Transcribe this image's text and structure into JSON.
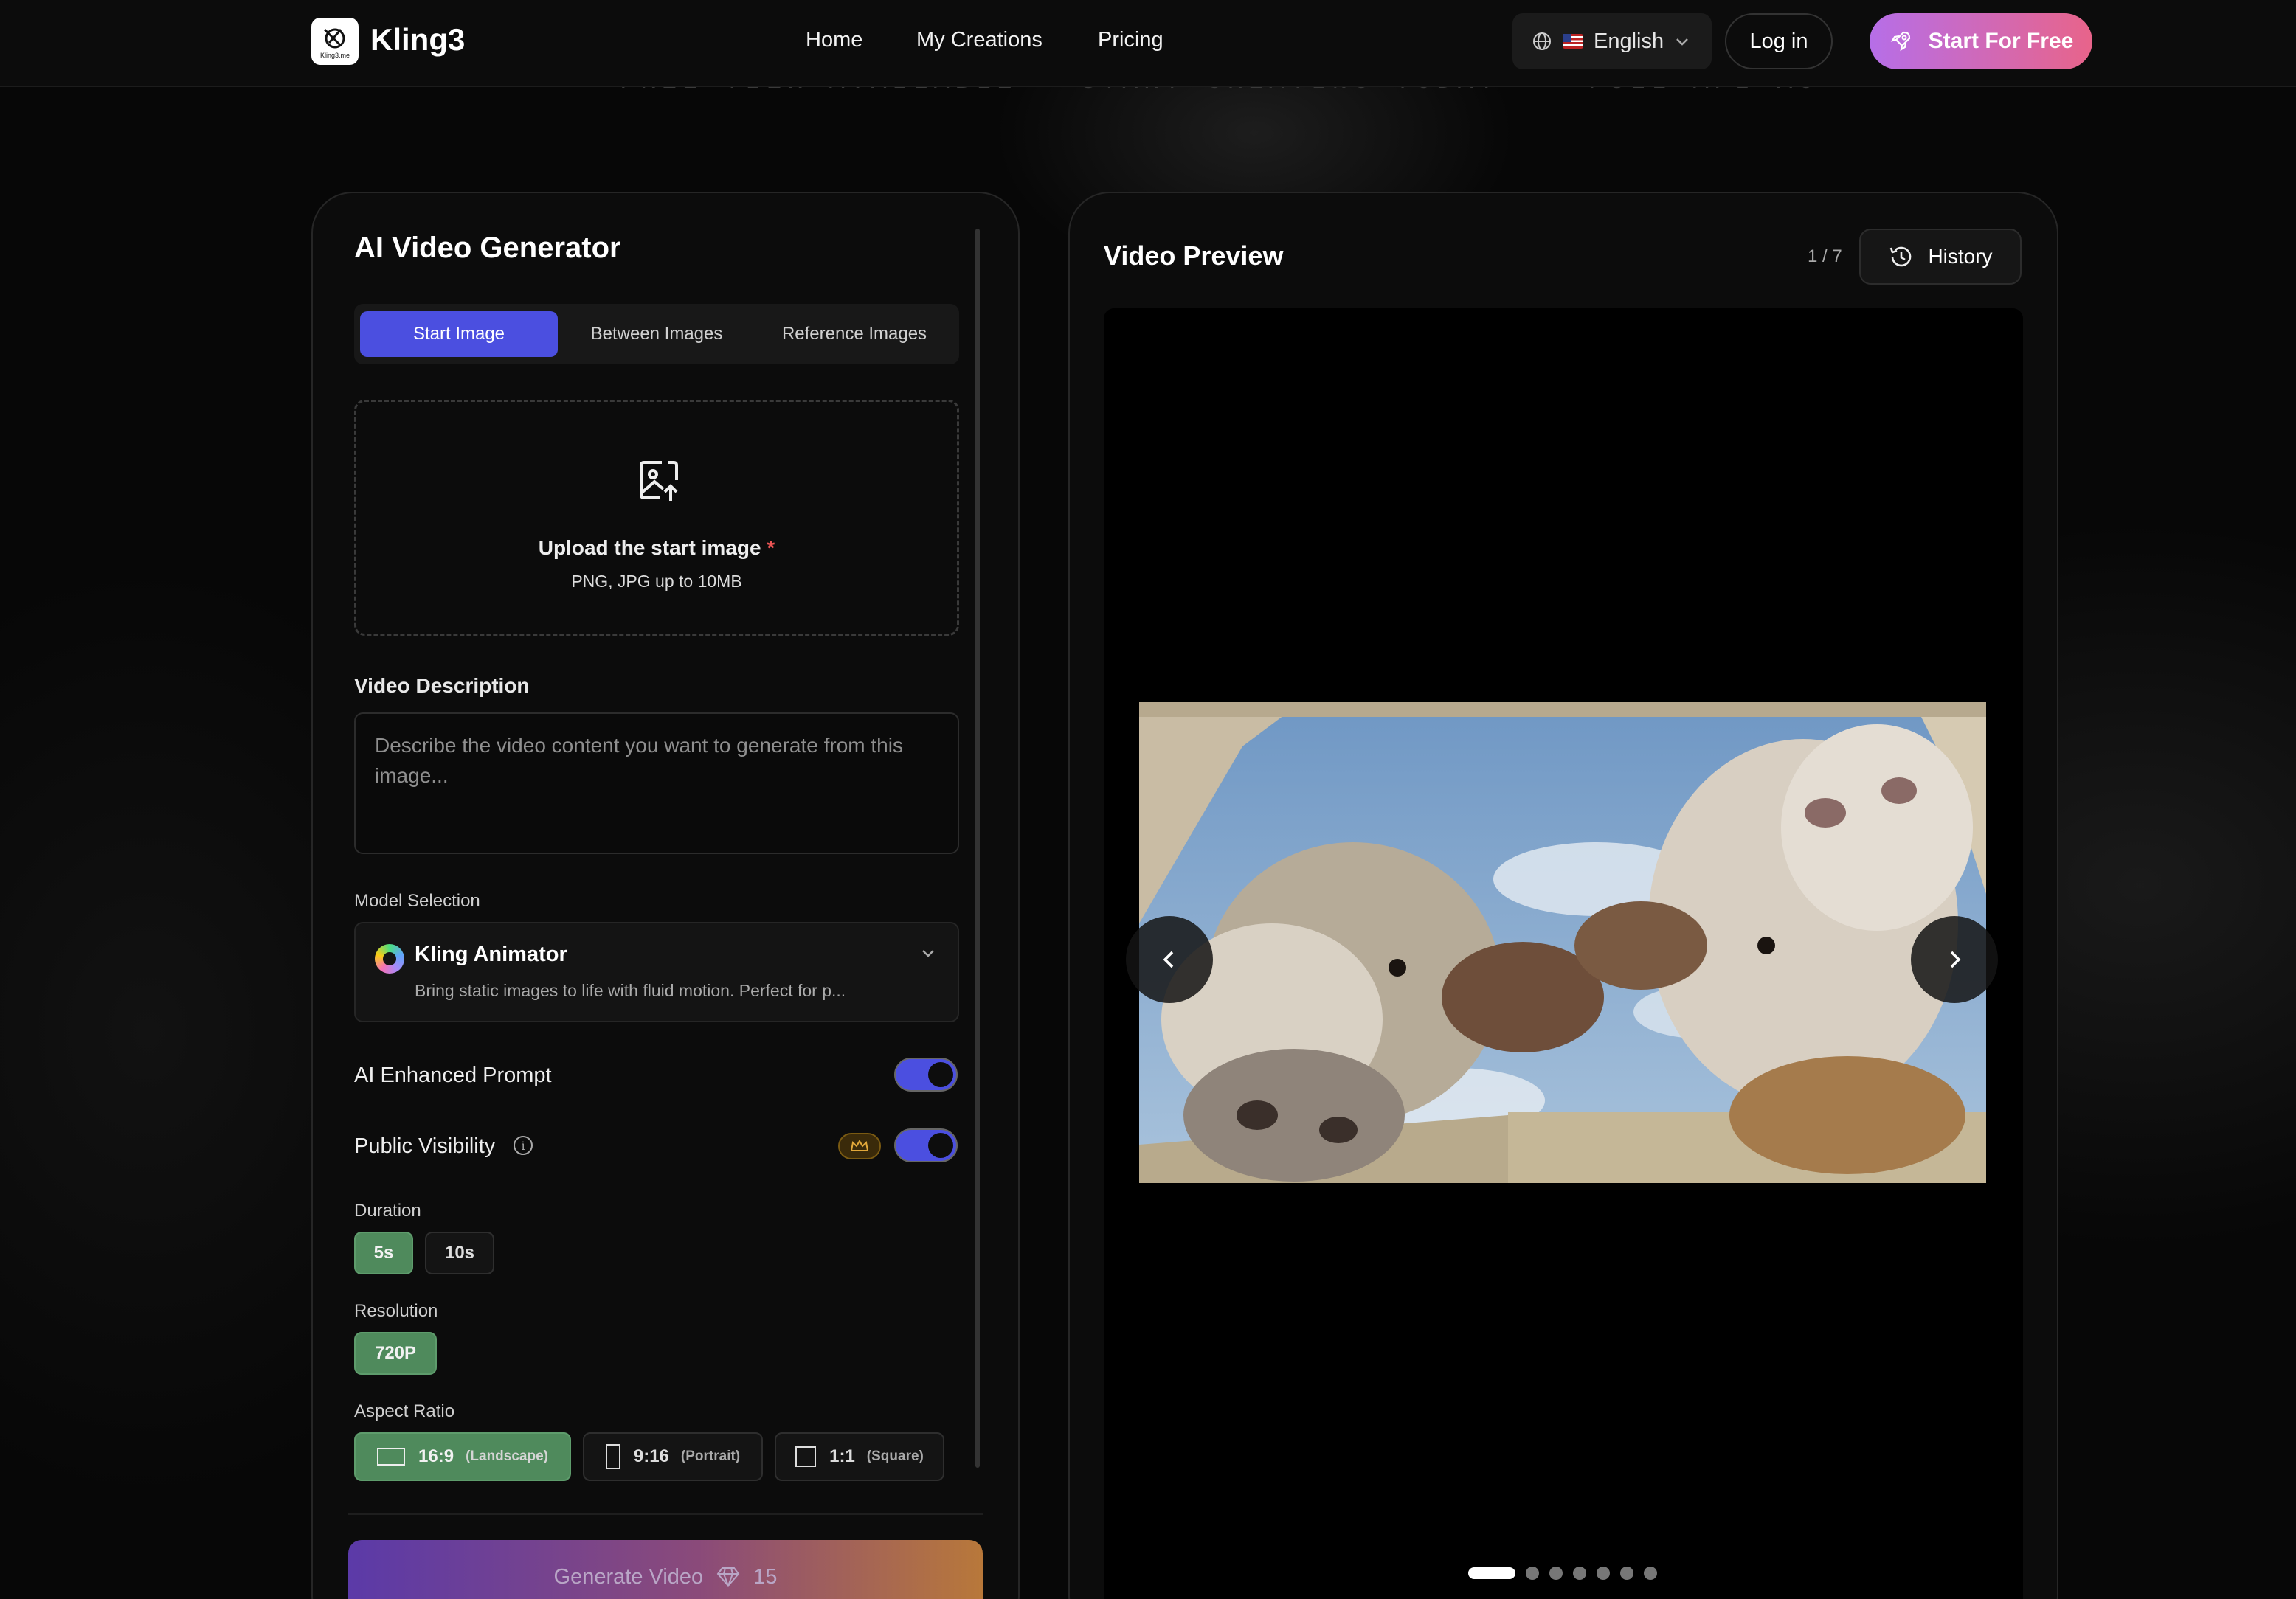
{
  "nav": {
    "brand": "Kling3",
    "logo_sub": "Kling3.me",
    "links": [
      "Home",
      "My Creations",
      "Pricing"
    ],
    "language": "English",
    "login": "Log in",
    "cta": "Start For Free"
  },
  "banner": {
    "items": [
      "FREE TIER AVAILABLE · START CREATING TODAY",
      "FULL API ACCESS FOR DEVELOPERS"
    ]
  },
  "generator": {
    "title": "AI Video Generator",
    "tabs": [
      "Start Image",
      "Between Images",
      "Reference Images"
    ],
    "active_tab": "Start Image",
    "upload": {
      "title": "Upload the start image",
      "required_mark": "*",
      "hint": "PNG, JPG up to 10MB"
    },
    "description": {
      "label": "Video Description",
      "placeholder": "Describe the video content you want to generate from this image..."
    },
    "model": {
      "label": "Model Selection",
      "name": "Kling Animator",
      "description": "Bring static images to life with fluid motion. Perfect for p..."
    },
    "ai_enhanced": {
      "label": "AI Enhanced Prompt",
      "enabled": true
    },
    "public_visibility": {
      "label": "Public Visibility",
      "enabled": true
    },
    "duration": {
      "label": "Duration",
      "options": [
        "5s",
        "10s"
      ],
      "selected": "5s"
    },
    "resolution": {
      "label": "Resolution",
      "options": [
        "720P"
      ],
      "selected": "720P"
    },
    "aspect_ratio": {
      "label": "Aspect Ratio",
      "options": [
        {
          "ratio": "16:9",
          "name": "(Landscape)"
        },
        {
          "ratio": "9:16",
          "name": "(Portrait)"
        },
        {
          "ratio": "1:1",
          "name": "(Square)"
        }
      ],
      "selected": "16:9"
    },
    "generate": {
      "label": "Generate Video",
      "cost": "15"
    }
  },
  "preview": {
    "title": "Video Preview",
    "counter": "1 / 7",
    "history": "History",
    "slide_count": 7,
    "active_slide": 1
  },
  "colors": {
    "accent": "#4b4fe0",
    "selected_chip": "#4f8a5c",
    "cta_start": "#b66ee8",
    "cta_end": "#e8648a"
  }
}
